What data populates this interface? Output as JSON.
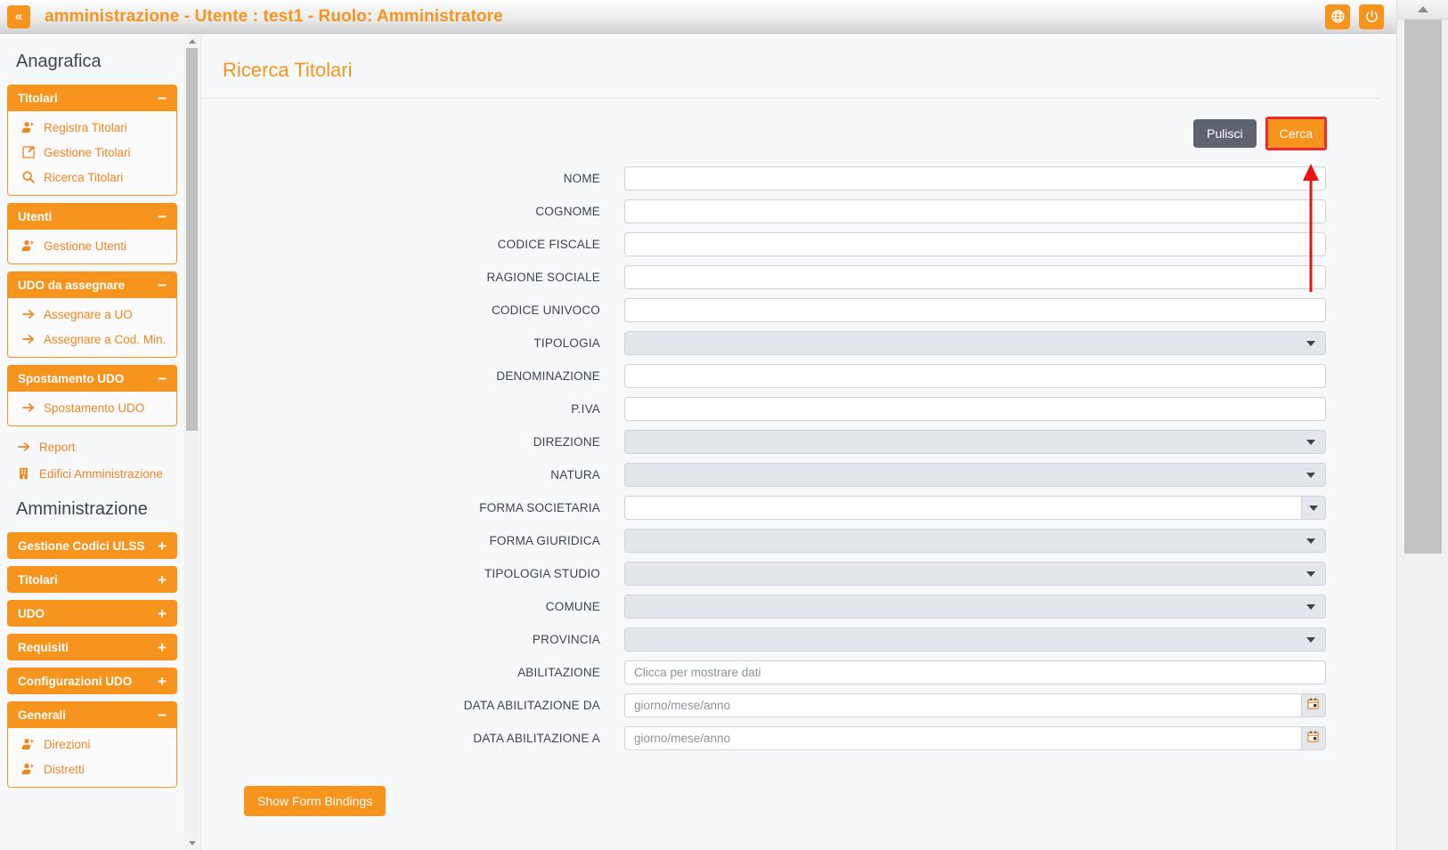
{
  "header": {
    "collapse_label": "«",
    "title": "amministrazione - Utente : test1 - Ruolo: Amministratore",
    "actions": [
      {
        "name": "language-icon",
        "label": ""
      },
      {
        "name": "power-icon",
        "label": ""
      }
    ]
  },
  "sidebar": {
    "sections": [
      {
        "title": "Anagrafica",
        "groups": [
          {
            "label": "Titolari",
            "toggle": "−",
            "open": true,
            "items": [
              {
                "label": "Registra Titolari",
                "icon": "user-add-icon"
              },
              {
                "label": "Gestione Titolari",
                "icon": "edit-square-icon"
              },
              {
                "label": "Ricerca Titolari",
                "icon": "search-icon"
              }
            ]
          },
          {
            "label": "Utenti",
            "toggle": "−",
            "open": true,
            "items": [
              {
                "label": "Gestione Utenti",
                "icon": "user-add-icon"
              }
            ]
          },
          {
            "label": "UDO da assegnare",
            "toggle": "−",
            "open": true,
            "items": [
              {
                "label": "Assegnare a UO",
                "icon": "arrow-right-icon"
              },
              {
                "label": "Assegnare a Cod. Min.",
                "icon": "arrow-right-icon"
              }
            ]
          },
          {
            "label": "Spostamento UDO",
            "toggle": "−",
            "open": true,
            "items": [
              {
                "label": "Spostamento UDO",
                "icon": "arrow-right-icon"
              }
            ]
          }
        ],
        "loose_items": [
          {
            "label": "Report",
            "icon": "arrow-right-icon"
          },
          {
            "label": "Edifici Amministrazione",
            "icon": "building-icon"
          }
        ]
      },
      {
        "title": "Amministrazione",
        "groups": [
          {
            "label": "Gestione Codici ULSS",
            "toggle": "+",
            "open": false,
            "items": []
          },
          {
            "label": "Titolari",
            "toggle": "+",
            "open": false,
            "items": []
          },
          {
            "label": "UDO",
            "toggle": "+",
            "open": false,
            "items": []
          },
          {
            "label": "Requisiti",
            "toggle": "+",
            "open": false,
            "items": []
          },
          {
            "label": "Configurazioni UDO",
            "toggle": "+",
            "open": false,
            "items": []
          },
          {
            "label": "Generali",
            "toggle": "−",
            "open": true,
            "items": [
              {
                "label": "Direzioni",
                "icon": "user-add-icon"
              },
              {
                "label": "Distretti",
                "icon": "user-add-icon"
              }
            ]
          }
        ],
        "loose_items": []
      }
    ]
  },
  "main": {
    "page_title": "Ricerca Titolari",
    "buttons": {
      "clear_label": "Pulisci",
      "search_label": "Cerca",
      "bindings_label": "Show Form Bindings"
    },
    "fields": [
      {
        "label": "NOME",
        "type": "text",
        "value": "",
        "placeholder": ""
      },
      {
        "label": "COGNOME",
        "type": "text",
        "value": "",
        "placeholder": ""
      },
      {
        "label": "CODICE FISCALE",
        "type": "text",
        "value": "",
        "placeholder": ""
      },
      {
        "label": "RAGIONE SOCIALE",
        "type": "text",
        "value": "",
        "placeholder": ""
      },
      {
        "label": "CODICE UNIVOCO",
        "type": "text",
        "value": "",
        "placeholder": ""
      },
      {
        "label": "TIPOLOGIA",
        "type": "select",
        "value": "",
        "placeholder": ""
      },
      {
        "label": "DENOMINAZIONE",
        "type": "text",
        "value": "",
        "placeholder": ""
      },
      {
        "label": "P.IVA",
        "type": "text",
        "value": "",
        "placeholder": ""
      },
      {
        "label": "DIREZIONE",
        "type": "select",
        "value": "",
        "placeholder": ""
      },
      {
        "label": "NATURA",
        "type": "select",
        "value": "",
        "placeholder": ""
      },
      {
        "label": "FORMA SOCIETARIA",
        "type": "combo",
        "value": "",
        "placeholder": ""
      },
      {
        "label": "FORMA GIURIDICA",
        "type": "select",
        "value": "",
        "placeholder": ""
      },
      {
        "label": "TIPOLOGIA STUDIO",
        "type": "select",
        "value": "",
        "placeholder": ""
      },
      {
        "label": "COMUNE",
        "type": "select",
        "value": "",
        "placeholder": ""
      },
      {
        "label": "PROVINCIA",
        "type": "select",
        "value": "",
        "placeholder": ""
      },
      {
        "label": "ABILITAZIONE",
        "type": "text",
        "value": "",
        "placeholder": "Clicca per mostrare dati"
      },
      {
        "label": "DATA ABILITAZIONE DA",
        "type": "date",
        "value": "",
        "placeholder": "giorno/mese/anno"
      },
      {
        "label": "DATA ABILITAZIONE A",
        "type": "date",
        "value": "",
        "placeholder": "giorno/mese/anno"
      }
    ]
  },
  "colors": {
    "accent": "#f7941e",
    "label_text": "#3c4450",
    "secondary_button": "#5d6470",
    "highlight": "#ef2929"
  }
}
